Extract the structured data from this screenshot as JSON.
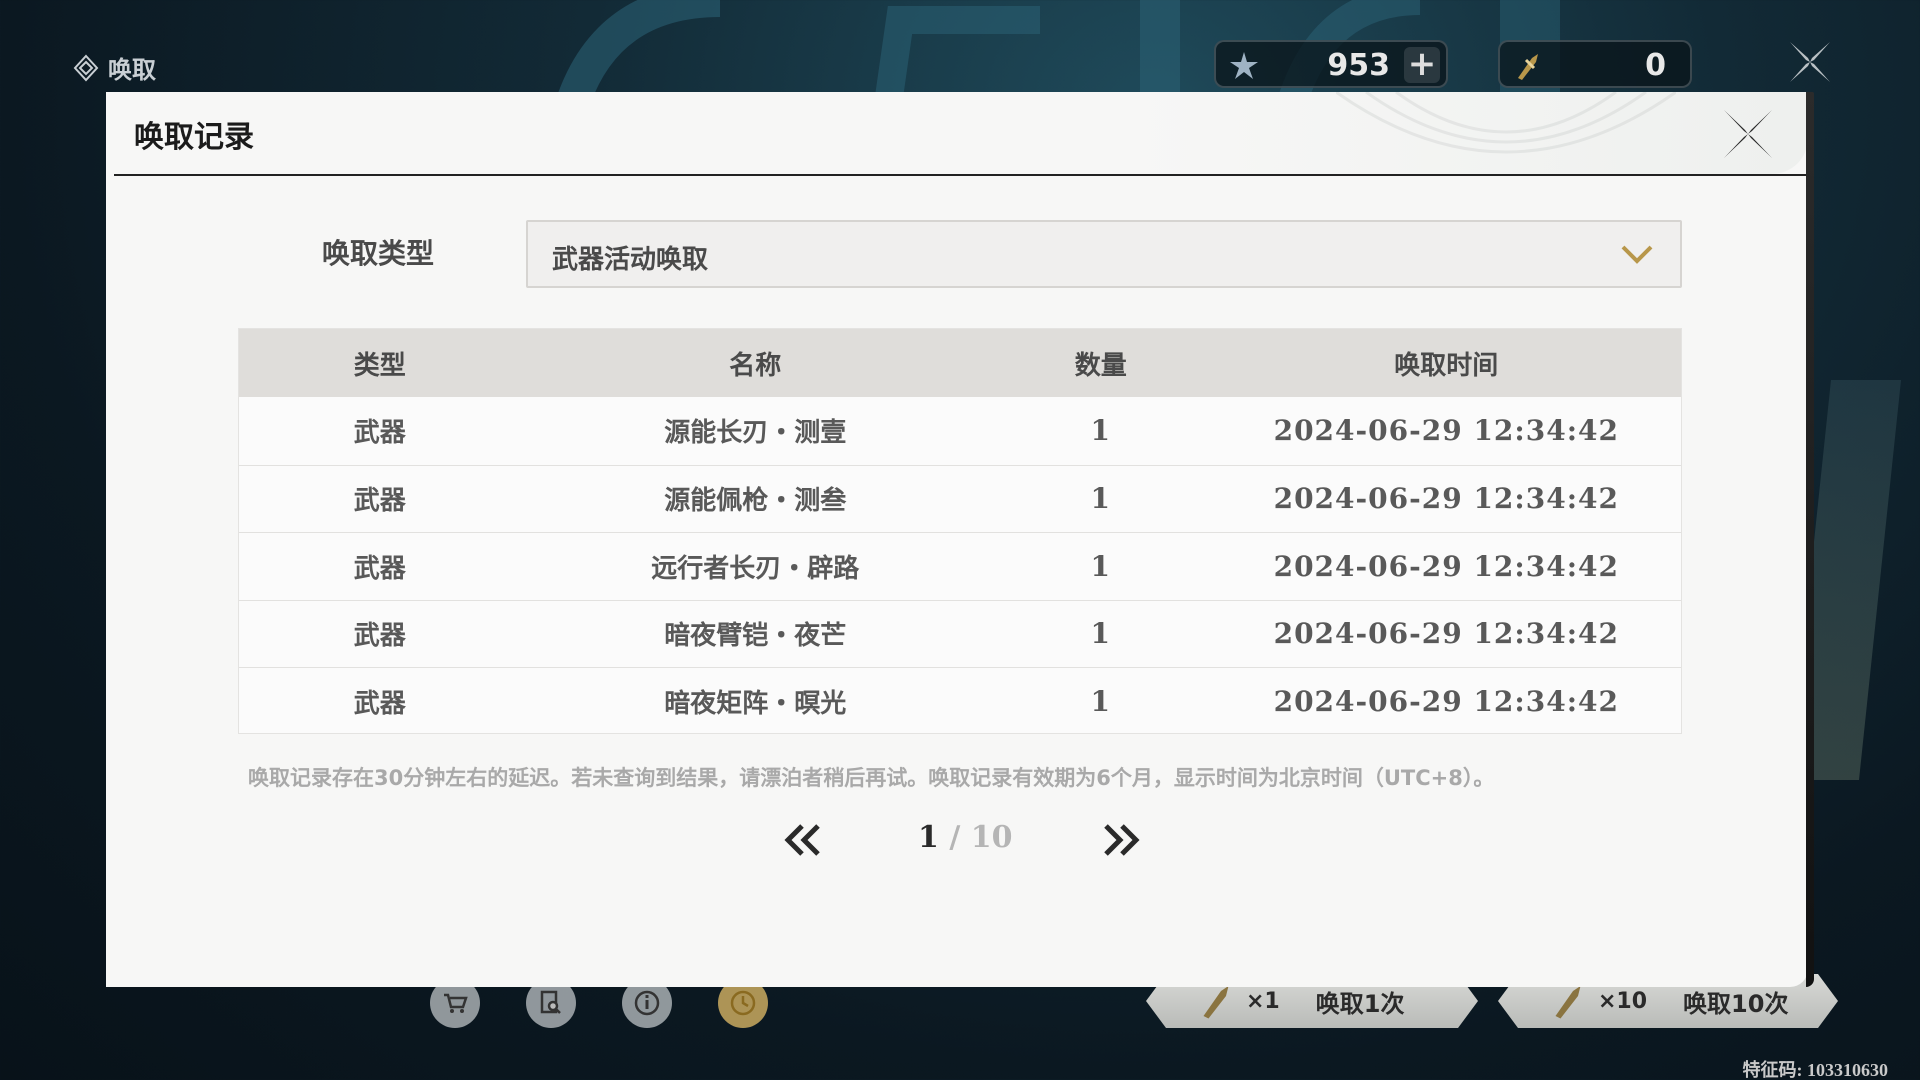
{
  "hud": {
    "title": "唤取",
    "currency_1": {
      "icon": "astrite-star-icon",
      "value": "953"
    },
    "currency_2": {
      "icon": "forging-tide-icon",
      "value": "0"
    },
    "uid": "特征码: 103310630"
  },
  "pull_buttons": [
    {
      "count": "×1",
      "label": "唤取1次"
    },
    {
      "count": "×10",
      "label": "唤取10次"
    }
  ],
  "modal": {
    "title": "唤取记录",
    "filter": {
      "label": "唤取类型",
      "selected": "武器活动唤取"
    },
    "table": {
      "headers": [
        "类型",
        "名称",
        "数量",
        "唤取时间"
      ],
      "rows": [
        {
          "type": "武器",
          "name": "源能长刃・测壹",
          "qty": "1",
          "time": "2024-06-29 12:34:42"
        },
        {
          "type": "武器",
          "name": "源能佩枪・测叁",
          "qty": "1",
          "time": "2024-06-29 12:34:42"
        },
        {
          "type": "武器",
          "name": "远行者长刃・辟路",
          "qty": "1",
          "time": "2024-06-29 12:34:42"
        },
        {
          "type": "武器",
          "name": "暗夜臂铠・夜芒",
          "qty": "1",
          "time": "2024-06-29 12:34:42"
        },
        {
          "type": "武器",
          "name": "暗夜矩阵・暝光",
          "qty": "1",
          "time": "2024-06-29 12:34:42"
        }
      ]
    },
    "note": "唤取记录存在30分钟左右的延迟。若未查询到结果，请漂泊者稍后再试。唤取记录有效期为6个月，显示时间为北京时间（UTC+8）。",
    "pagination": {
      "current": "1",
      "separator": "/",
      "total": "10"
    }
  },
  "colors": {
    "accent_gold": "#b8974a",
    "modal_bg": "#f7f7f6",
    "table_header_bg": "#dfddda"
  }
}
